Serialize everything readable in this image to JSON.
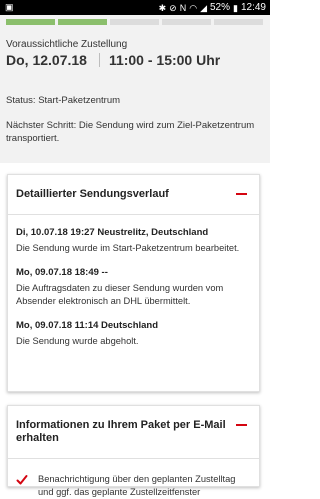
{
  "status_bar": {
    "battery": "52%",
    "time": "12:49"
  },
  "delivery": {
    "progress_segments_done": 2,
    "progress_segments_total": 5,
    "estimated_label": "Voraussichtliche Zustellung",
    "date": "Do, 12.07.18",
    "time_window": "11:00 - 15:00 Uhr",
    "status": "Status: Start-Paketzentrum",
    "next_step": "Nächster Schritt: Die Sendung wird zum Ziel-Paketzentrum transportiert."
  },
  "history": {
    "title": "Detaillierter Sendungsverlauf",
    "events": [
      {
        "header": "Di, 10.07.18 19:27 Neustrelitz, Deutschland",
        "text": "Die Sendung wurde im Start-Paketzentrum bearbeitet."
      },
      {
        "header": "Mo, 09.07.18 18:49 --",
        "text": "Die Auftragsdaten zu dieser Sendung wurden vom Absender elektronisch an DHL übermittelt."
      },
      {
        "header": "Mo, 09.07.18 11:14 Deutschland",
        "text": "Die Sendung wurde abgeholt."
      }
    ]
  },
  "email_info": {
    "title": "Informationen zu Ihrem Paket per E-Mail erhalten",
    "option_text": "Benachrichtigung über den geplanten Zustelltag und ggf. das geplante Zustellzeitfenster"
  },
  "colors": {
    "accent_red": "#d40511",
    "progress_green": "#8bbf6c"
  }
}
